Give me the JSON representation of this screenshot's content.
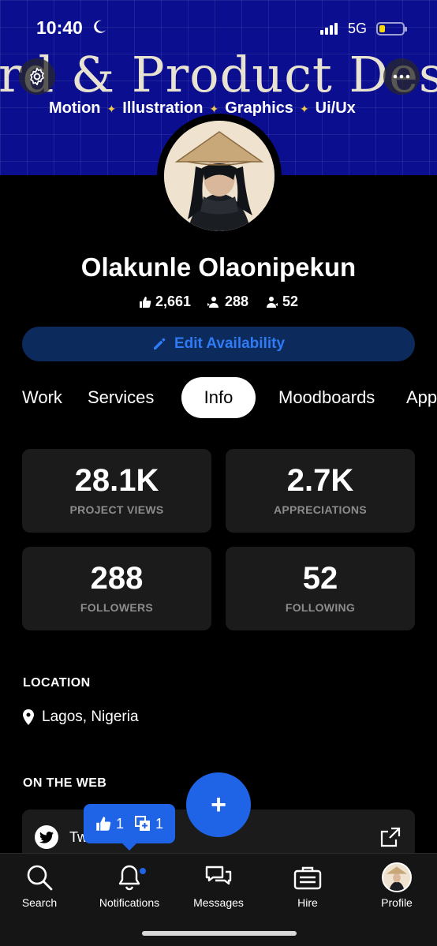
{
  "status_bar": {
    "time": "10:40",
    "network": "5G"
  },
  "banner": {
    "title": "ard & Product Design",
    "subtitle_items": [
      "Motion",
      "Illustration",
      "Graphics",
      "Ui/Ux"
    ],
    "separator": "✦"
  },
  "profile": {
    "name": "Olakunle Olaonipekun",
    "appreciations_count": "2,661",
    "followers_count": "288",
    "following_count": "52"
  },
  "edit_button": {
    "label": "Edit Availability"
  },
  "tabs": [
    {
      "label": "Work",
      "active": false
    },
    {
      "label": "Services",
      "active": false
    },
    {
      "label": "Info",
      "active": true
    },
    {
      "label": "Moodboards",
      "active": false
    },
    {
      "label": "App",
      "active": false
    }
  ],
  "stat_cards": [
    {
      "value": "28.1K",
      "label": "PROJECT VIEWS"
    },
    {
      "value": "2.7K",
      "label": "APPRECIATIONS"
    },
    {
      "value": "288",
      "label": "FOLLOWERS"
    },
    {
      "value": "52",
      "label": "FOLLOWING"
    }
  ],
  "location": {
    "title": "LOCATION",
    "value": "Lagos, Nigeria"
  },
  "on_the_web": {
    "title": "ON THE WEB",
    "link_label": "Tw"
  },
  "tooltip": {
    "likes": "1",
    "adds": "1"
  },
  "fab": {
    "label": "+"
  },
  "bottom_nav": [
    {
      "label": "Search",
      "icon": "search-icon"
    },
    {
      "label": "Notifications",
      "icon": "bell-icon"
    },
    {
      "label": "Messages",
      "icon": "chat-icon"
    },
    {
      "label": "Hire",
      "icon": "briefcase-icon"
    },
    {
      "label": "Profile",
      "icon": "avatar"
    }
  ],
  "colors": {
    "accent": "#1f63e6",
    "banner": "#0b0f8f",
    "card": "#1b1b1b",
    "edit_bg": "#0d2a5c",
    "edit_text": "#2f7bf5"
  }
}
